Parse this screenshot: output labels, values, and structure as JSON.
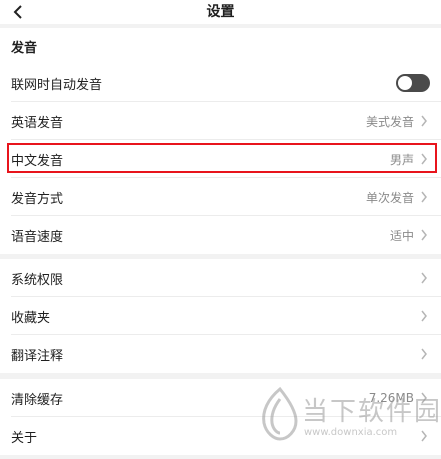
{
  "header": {
    "title": "设置"
  },
  "pronunciation": {
    "section_label": "发音",
    "items": [
      {
        "label": "联网时自动发音",
        "toggle": "off"
      },
      {
        "label": "英语发音",
        "value": "美式发音"
      },
      {
        "label": "中文发音",
        "value": "男声"
      },
      {
        "label": "发音方式",
        "value": "单次发音"
      },
      {
        "label": "语音速度",
        "value": "适中"
      }
    ]
  },
  "general": {
    "items": [
      {
        "label": "系统权限"
      },
      {
        "label": "收藏夹"
      },
      {
        "label": "翻译注释"
      }
    ]
  },
  "misc": {
    "items": [
      {
        "label": "清除缓存",
        "value": "7.26MB"
      },
      {
        "label": "关于"
      }
    ]
  },
  "watermark": {
    "text": "当下软件园",
    "url": "www.downxia.com"
  },
  "colors": {
    "highlight": "#e8141c",
    "toggle_off": "#4a4a4a"
  }
}
